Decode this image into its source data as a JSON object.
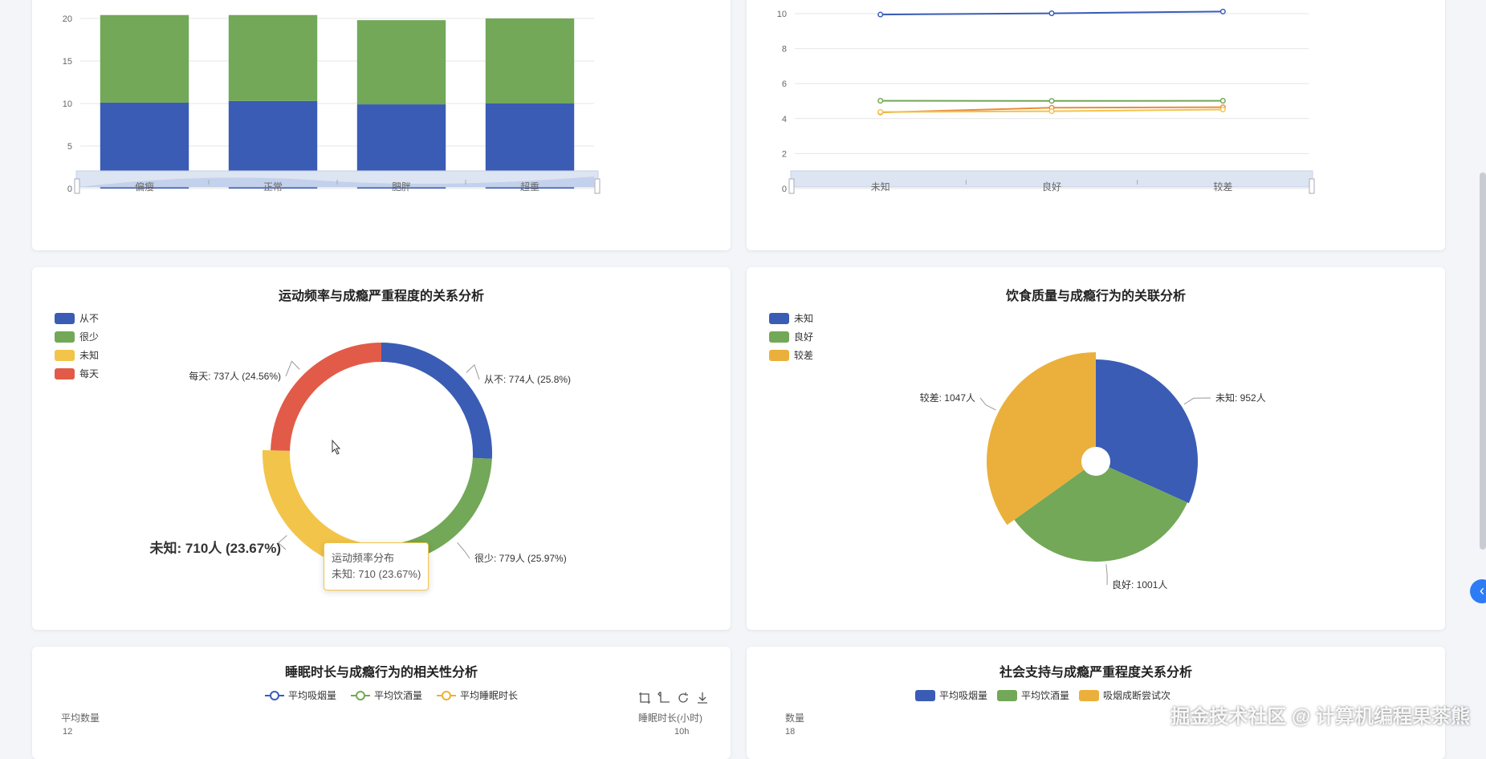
{
  "colors": {
    "blue": "#3a5cb5",
    "green": "#72a857",
    "yellow": "#f2c44a",
    "red": "#e25b48",
    "orange": "#e98d3b",
    "gold": "#ebb03b"
  },
  "charts": {
    "bmi_bar": {
      "chart_data": {
        "type": "bar",
        "categories": [
          "偏瘦",
          "正常",
          "肥胖",
          "超重"
        ],
        "series": [
          {
            "values": [
              10.1,
              10.3,
              9.9,
              10.0
            ]
          },
          {
            "values": [
              10.3,
              10.1,
              9.9,
              10.0
            ]
          }
        ],
        "ylim": [
          0,
          20
        ],
        "yticks": [
          "0",
          "5",
          "10",
          "15",
          "20"
        ],
        "stacked": true,
        "grid": true
      }
    },
    "diet_line": {
      "chart_data": {
        "type": "line",
        "categories": [
          "未知",
          "良好",
          "较差"
        ],
        "series": [
          {
            "values": [
              9.95,
              10.02,
              10.12
            ]
          },
          {
            "values": [
              5.02,
              5.01,
              5.02
            ]
          },
          {
            "values": [
              4.35,
              4.62,
              4.65
            ]
          },
          {
            "values": [
              4.38,
              4.42,
              4.52
            ]
          }
        ],
        "ylim": [
          0,
          10
        ],
        "yticks": [
          "0",
          "2",
          "4",
          "6",
          "8",
          "10"
        ],
        "grid": true
      }
    },
    "exercise_donut": {
      "title": "运动频率与成瘾严重程度的关系分析",
      "legend": [
        "从不",
        "很少",
        "未知",
        "每天"
      ],
      "chart_data": {
        "type": "pie",
        "title": "运动频率与成瘾严重程度的关系分析",
        "slices": [
          {
            "name": "从不",
            "value": 774,
            "percent": 25.8,
            "label": "从不: 774人 (25.8%)"
          },
          {
            "name": "很少",
            "value": 779,
            "percent": 25.97,
            "label": "很少: 779人 (25.97%)"
          },
          {
            "name": "未知",
            "value": 710,
            "percent": 23.67,
            "label": "未知: 710人 (23.67%)"
          },
          {
            "name": "每天",
            "value": 737,
            "percent": 24.56,
            "label": "每天: 737人 (24.56%)"
          }
        ]
      },
      "tooltip": {
        "title": "运动频率分布",
        "value": "未知: 710 (23.67%)"
      }
    },
    "diet_pie": {
      "title": "饮食质量与成瘾行为的关联分析",
      "legend": [
        "未知",
        "良好",
        "较差"
      ],
      "chart_data": {
        "type": "pie",
        "title": "饮食质量与成瘾行为的关联分析",
        "slices": [
          {
            "name": "未知",
            "value": 952,
            "label": "未知: 952人"
          },
          {
            "name": "良好",
            "value": 1001,
            "label": "良好: 1001人"
          },
          {
            "name": "较差",
            "value": 1047,
            "label": "较差: 1047人"
          }
        ]
      }
    },
    "sleep": {
      "title": "睡眠时长与成瘾行为的相关性分析",
      "legend": [
        "平均吸烟量",
        "平均饮酒量",
        "平均睡眠时长"
      ],
      "y_left_label": "平均数量",
      "y_right_label": "睡眠时长(小时)",
      "y_left_top": "12",
      "y_right_top": "10h"
    },
    "social": {
      "title": "社会支持与成瘾严重程度关系分析",
      "legend": [
        "平均吸烟量",
        "平均饮酒量",
        "吸烟成断尝试次"
      ],
      "y_label": "数量",
      "y_top": "18"
    }
  },
  "watermark": "掘金技术社区 @ 计算机编程果茶熊"
}
